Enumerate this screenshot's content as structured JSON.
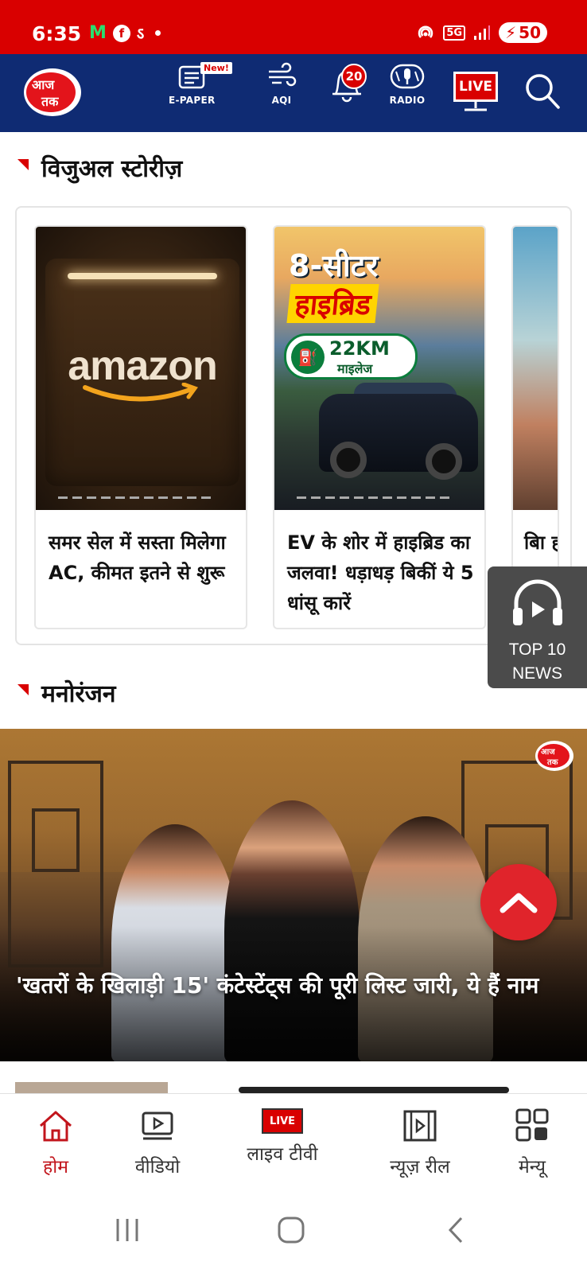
{
  "status_bar": {
    "time": "6:35",
    "battery": "50",
    "network": "5G"
  },
  "header": {
    "logo_text": "आज तक",
    "epaper_label": "E-PAPER",
    "epaper_new_tag": "New!",
    "aqi_label": "AQI",
    "notification_count": "20",
    "radio_label": "RADIO",
    "live_label": "LIVE"
  },
  "visual_stories": {
    "heading": "विजुअल स्टोरीज़",
    "cards": [
      {
        "caption": "समर सेल में सस्ता मिलेगा AC, कीमत इतने से शुरू",
        "image_text": "amazon"
      },
      {
        "caption": "EV के शोर में हाइब्रिड का जलवा! धड़ाधड़ बिकीं ये 5 धांसू कारें",
        "image_line1": "8-सीटर",
        "image_line2": "हाइब्रिड",
        "image_mileage": "22KM",
        "image_mileage_label": "माइलेज"
      },
      {
        "caption": "बिा हर्म"
      }
    ]
  },
  "top10": {
    "line1": "TOP 10",
    "line2": "NEWS"
  },
  "entertainment": {
    "heading": "मनोरंजन",
    "headline": "'खतरों के खिलाड़ी 15' कंटेस्टेंट्स की पूरी लिस्ट जारी, ये हैं नाम"
  },
  "bottom_nav": {
    "items": [
      {
        "label": "होम",
        "icon": "home-icon",
        "active": true
      },
      {
        "label": "वीडियो",
        "icon": "video-icon",
        "active": false
      },
      {
        "label": "लाइव टीवी",
        "icon": "live-tv-icon",
        "active": false,
        "badge": "LIVE"
      },
      {
        "label": "न्यूज़ रील",
        "icon": "reel-icon",
        "active": false
      },
      {
        "label": "मेन्यू",
        "icon": "menu-grid-icon",
        "active": false
      }
    ]
  },
  "colors": {
    "brand_red": "#d90000",
    "header_navy": "#0f2b73",
    "active_red": "#c2151c"
  }
}
